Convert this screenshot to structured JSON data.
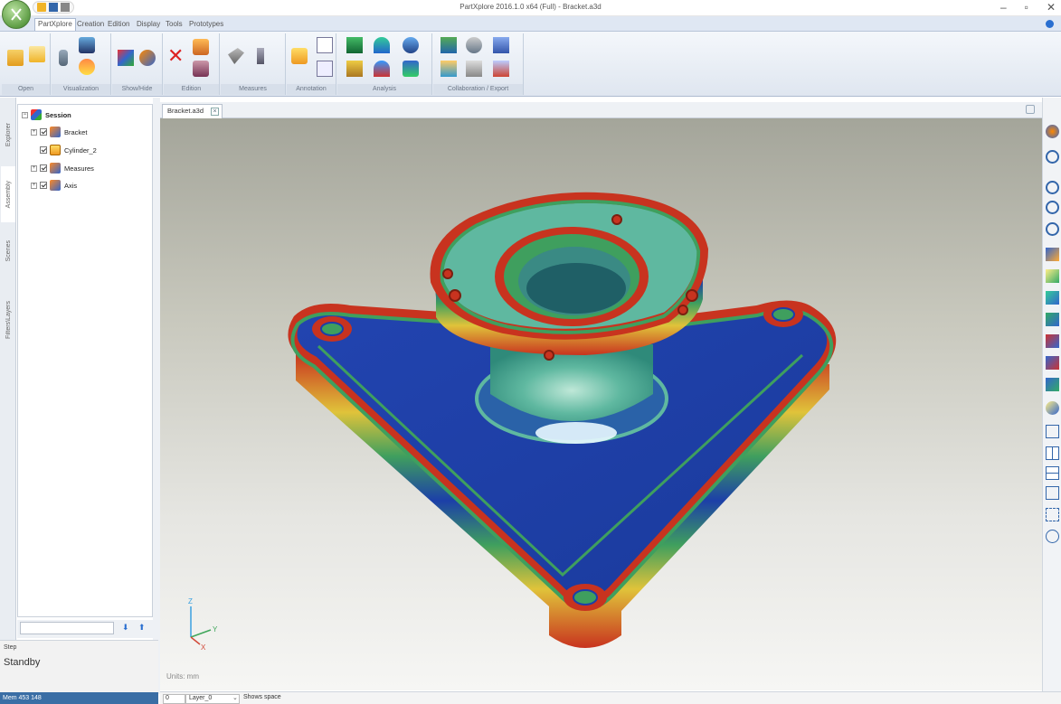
{
  "window": {
    "title": "PartXplore 2016.1.0 x64 (Full) - Bracket.a3d",
    "minimize": "–",
    "maximize": "▫",
    "close": "✕"
  },
  "tabs": [
    "PartXplore",
    "Creation",
    "Edition",
    "Display",
    "Tools",
    "Prototypes"
  ],
  "ribbon": {
    "groups": [
      "Open",
      "Visualization",
      "Show/Hide",
      "Edition",
      "Measures",
      "Annotation",
      "Analysis",
      "Collaboration / Export"
    ]
  },
  "side_tabs": [
    "Explorer",
    "Assembly",
    "Scenes",
    "Filters\\Layers"
  ],
  "tree": {
    "root": "Session",
    "items": [
      "Bracket",
      "Cylinder_2",
      "Measures",
      "Axis"
    ]
  },
  "search": {
    "value": ""
  },
  "step": {
    "label": "Step",
    "state": "Standby"
  },
  "memory": "Mem 453 148",
  "document": {
    "tab": "Bracket.a3d"
  },
  "viewport": {
    "units": "Units: mm",
    "axes": {
      "z": "Z",
      "y": "Y",
      "x": "X"
    }
  },
  "status": {
    "layer_index": "0",
    "layer": "Layer_0",
    "message": "Shows space"
  },
  "colors": {
    "accent": "#2a6fd0",
    "model_blue": "#1c3fa8",
    "model_red": "#c8331f",
    "model_green": "#3f9f5e",
    "model_teal": "#5fb8a0"
  }
}
